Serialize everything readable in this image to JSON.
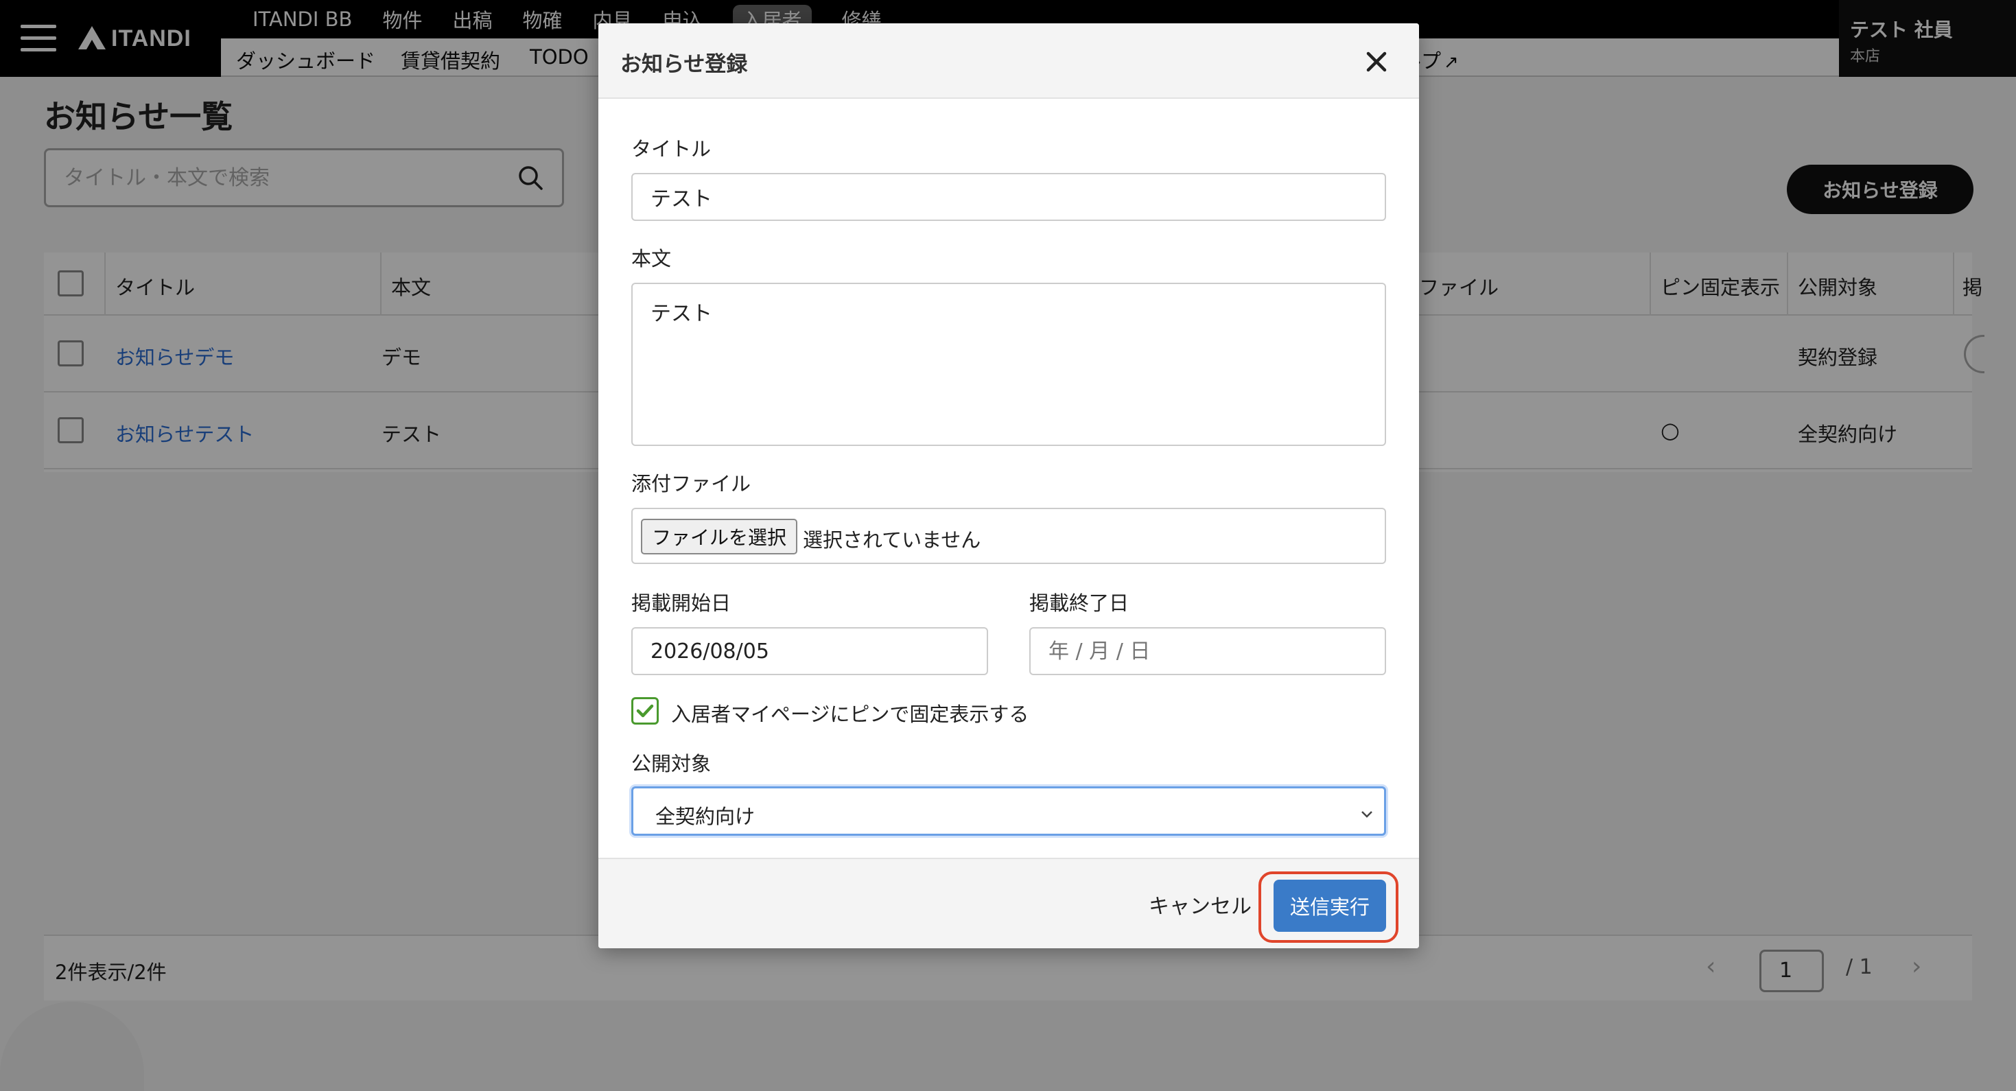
{
  "header": {
    "logo": "ITANDI",
    "nav_primary": [
      "ITANDI BB",
      "物件",
      "出稿",
      "物確",
      "内見",
      "申込",
      "入居者",
      "修繕"
    ],
    "nav_active_index": 6,
    "nav_secondary": [
      "ダッシュボード",
      "賃貸借契約",
      "TODO",
      "ルプ"
    ],
    "user_name": "テスト 社員",
    "user_branch": "本店"
  },
  "page": {
    "title": "お知らせ一覧",
    "search_placeholder": "タイトル・本文で検索",
    "register_button": "お知らせ登録"
  },
  "table": {
    "columns": [
      "タイトル",
      "本文",
      "ファイル",
      "ピン固定表示",
      "公開対象",
      "掲"
    ],
    "rows": [
      {
        "title": "お知らせデモ",
        "body": "デモ",
        "pinned": false,
        "target": "契約登録"
      },
      {
        "title": "お知らせテスト",
        "body": "テスト",
        "pinned": true,
        "target": "全契約向け"
      }
    ],
    "pinned_mark": "○"
  },
  "footer": {
    "count": "2件表示/2件",
    "page": "1",
    "total": "/ 1",
    "prev": "‹",
    "next": "›"
  },
  "modal": {
    "title": "お知らせ登録",
    "title_label": "タイトル",
    "title_value": "テスト",
    "body_label": "本文",
    "body_value": "テスト",
    "file_label": "添付ファイル",
    "file_button": "ファイルを選択",
    "file_status": "選択されていません",
    "start_label": "掲載開始日",
    "start_value": "2026/08/05",
    "end_label": "掲載終了日",
    "end_placeholder": "年 / 月 / 日",
    "pin_label": "入居者マイページにピンで固定表示する",
    "pin_checked": true,
    "target_label": "公開対象",
    "target_value": "全契約向け",
    "cancel": "キャンセル",
    "submit": "送信実行"
  },
  "colors": {
    "link": "#2a6bd1",
    "submit": "#3a7bc8",
    "highlight": "#e0452b",
    "check": "#4a9a2e"
  }
}
